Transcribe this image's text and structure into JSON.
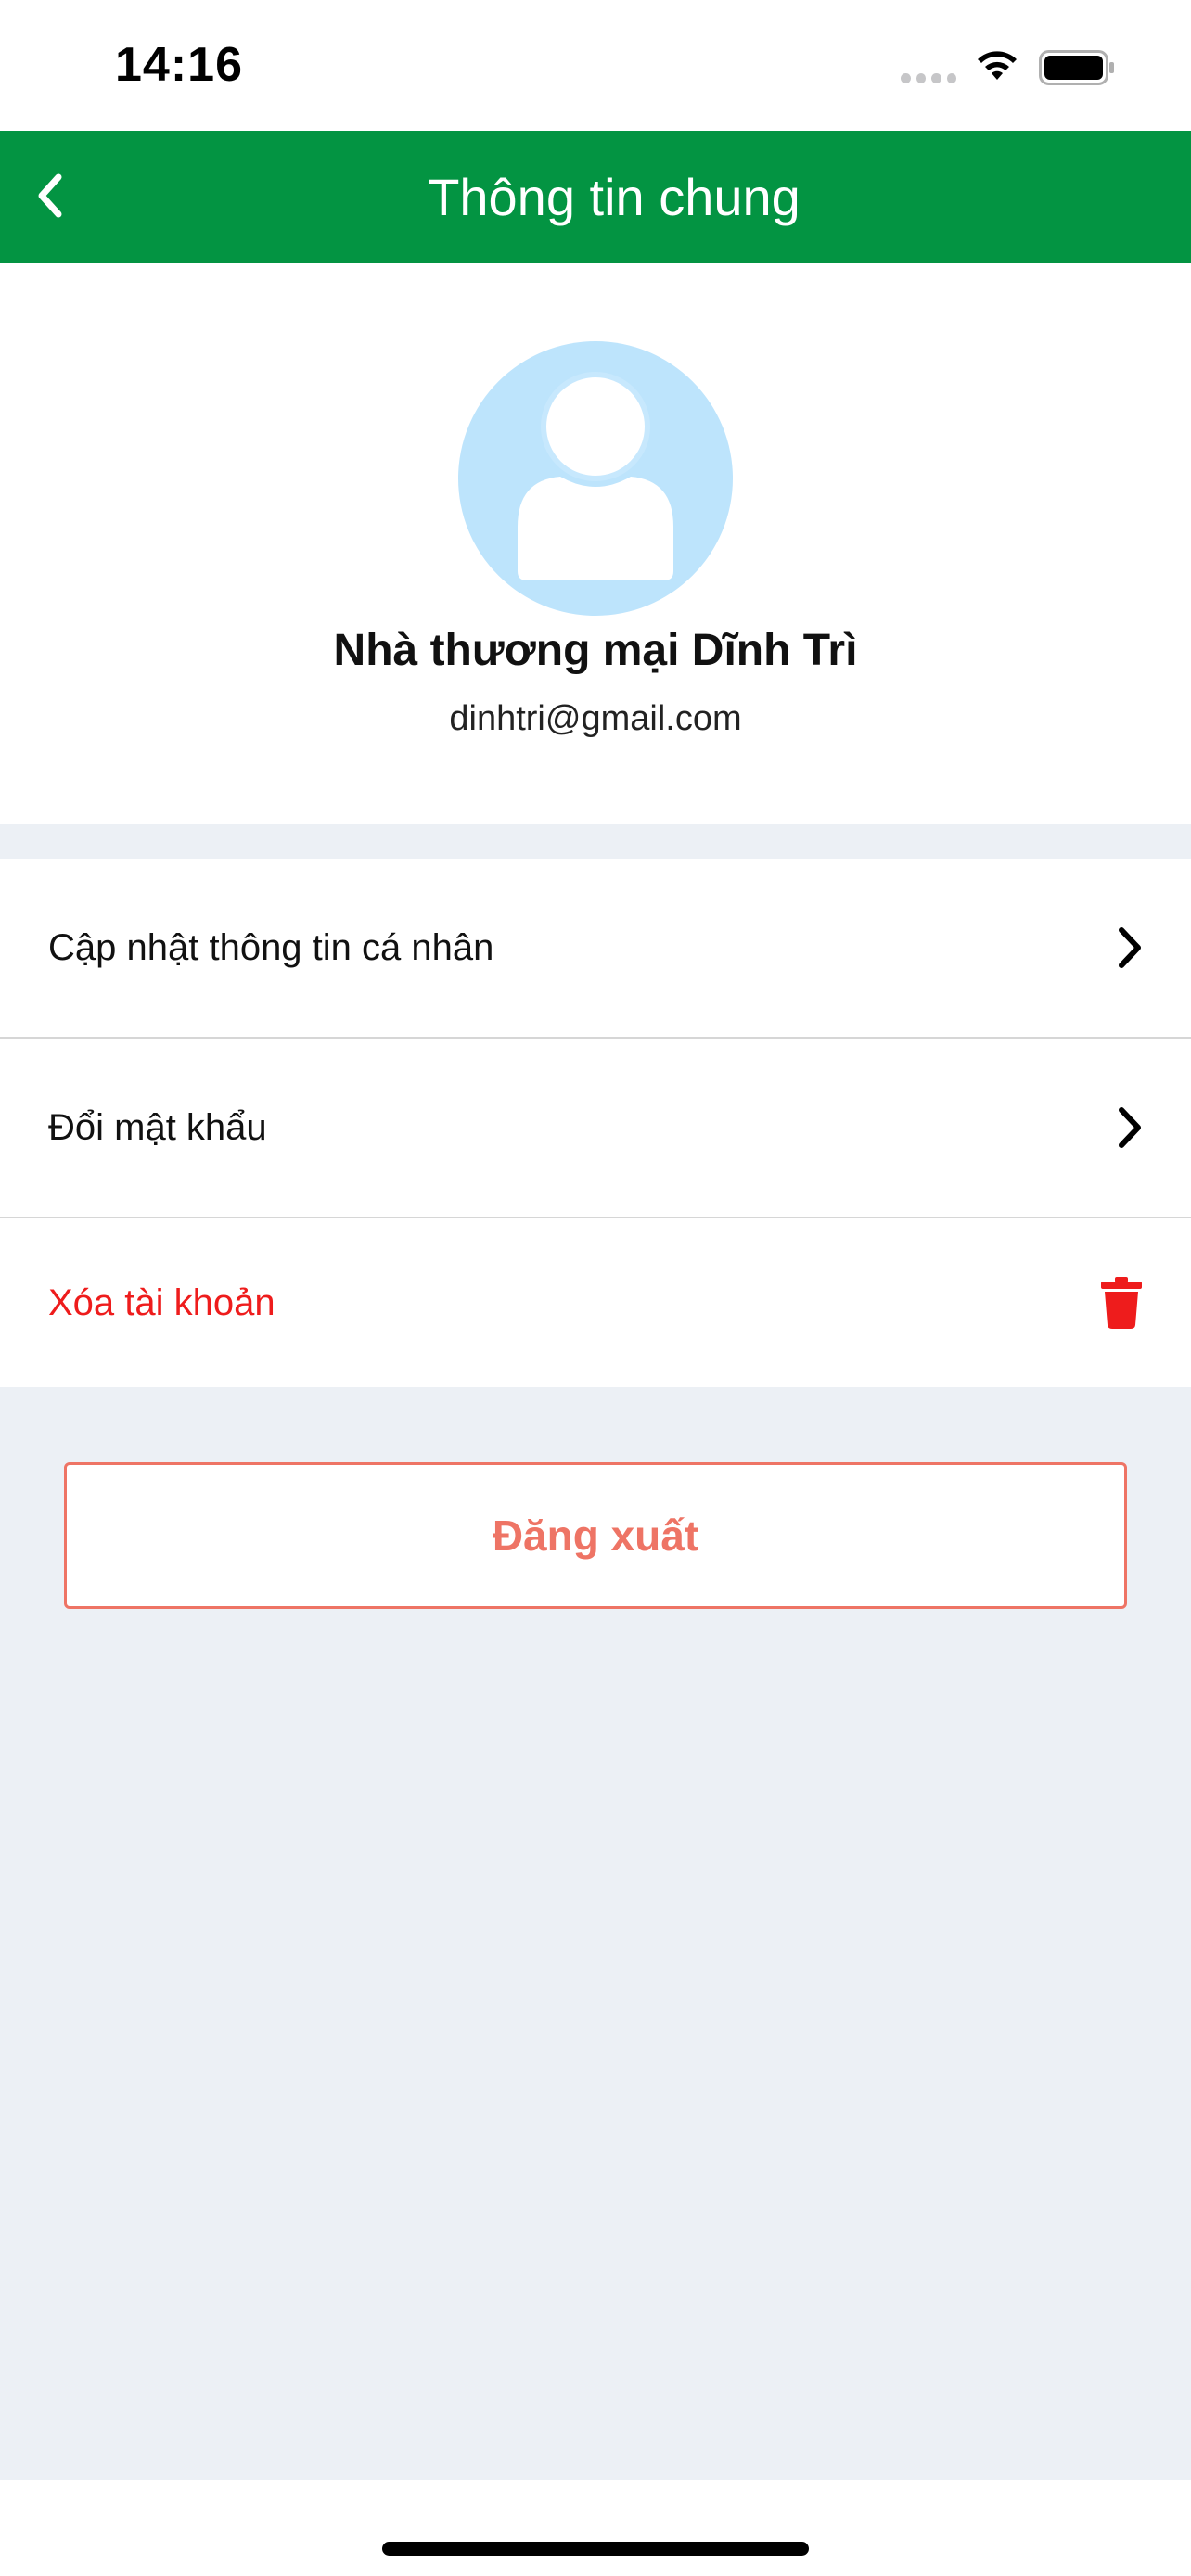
{
  "status_bar": {
    "time": "14:16"
  },
  "header": {
    "title": "Thông tin chung",
    "back_icon": "chevron-left-icon",
    "background_color": "#039442"
  },
  "profile": {
    "name": "Nhà thương mại Dĩnh Trì",
    "email": "dinhtri@gmail.com",
    "avatar_icon": "user-placeholder-icon",
    "avatar_color": "#bde4fc"
  },
  "menu": {
    "items": [
      {
        "label": "Cập nhật thông tin cá nhân",
        "icon": "chevron-right-icon"
      },
      {
        "label": "Đổi mật khẩu",
        "icon": "chevron-right-icon"
      },
      {
        "label": "Xóa tài khoản",
        "icon": "trash-icon",
        "color": "#ee1c1c"
      }
    ]
  },
  "logout": {
    "label": "Đăng xuất",
    "color": "#ee7465"
  },
  "colors": {
    "background_gray": "#ecf0f5"
  }
}
